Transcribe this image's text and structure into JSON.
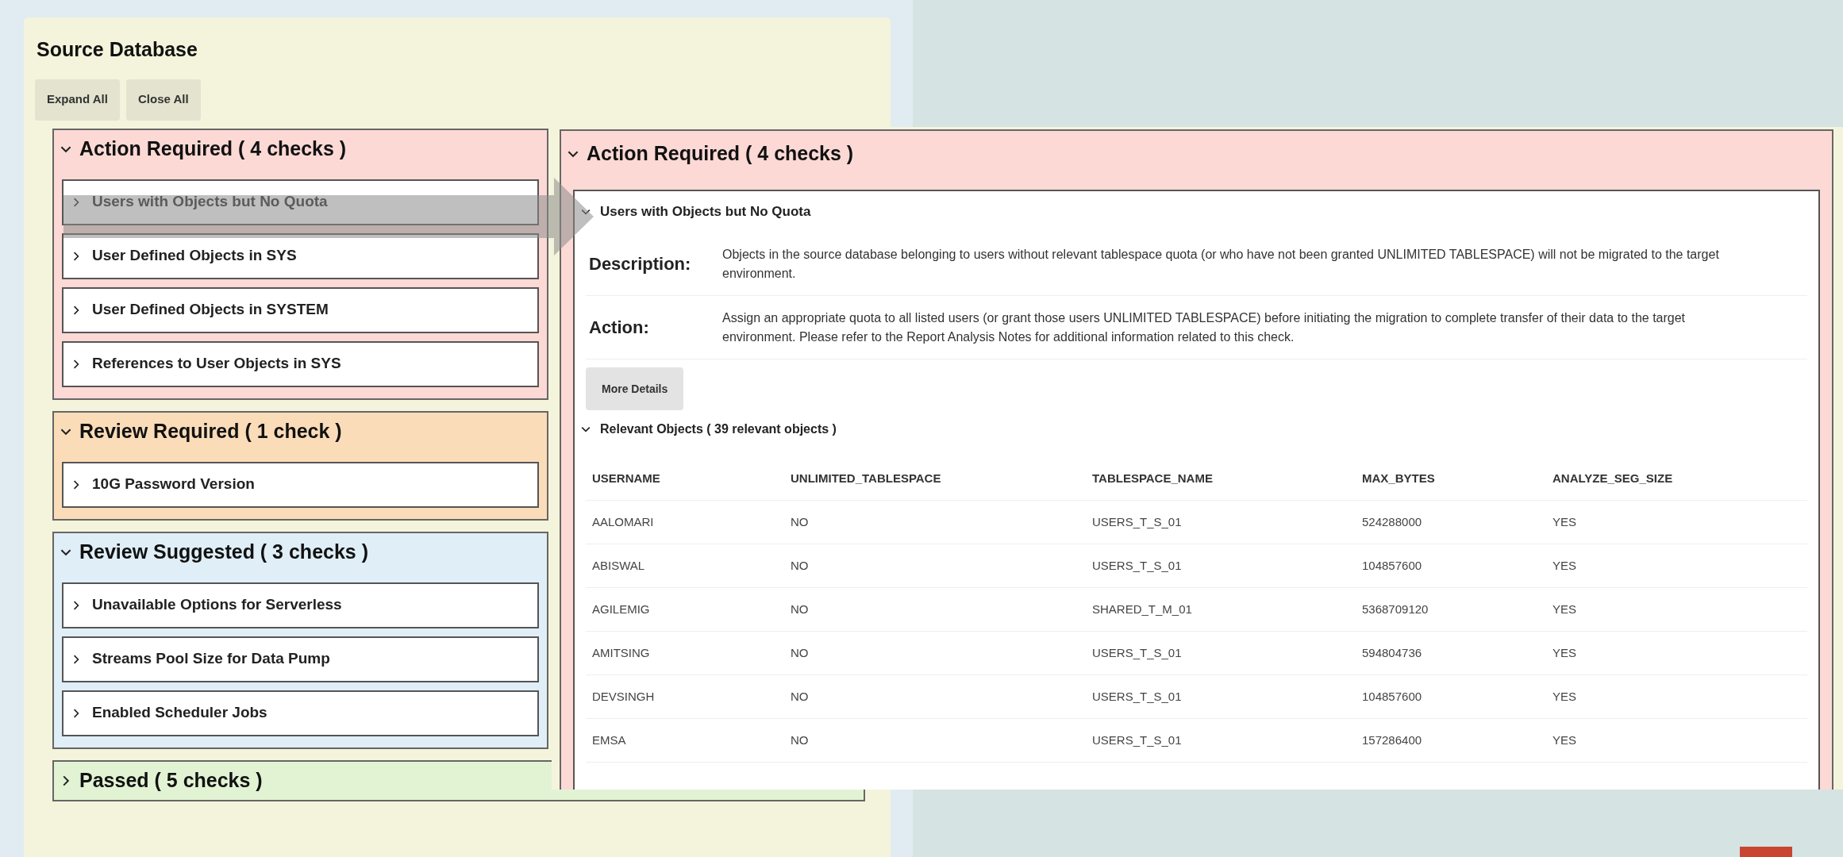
{
  "panel": {
    "title": "Source Database",
    "buttons": [
      "Expand All",
      "Close All"
    ],
    "sections": [
      {
        "kind": "action",
        "title": "Action Required ( 4 checks )",
        "expanded": true,
        "items": [
          "Users with Objects but No Quota",
          "User Defined Objects in SYS",
          "User Defined Objects in SYSTEM",
          "References to User Objects in SYS"
        ]
      },
      {
        "kind": "review_required",
        "title": "Review Required ( 1 check )",
        "expanded": true,
        "items": [
          "10G Password Version"
        ]
      },
      {
        "kind": "review_suggested",
        "title": "Review Suggested ( 3 checks )",
        "expanded": true,
        "items": [
          "Unavailable Options for Serverless",
          "Streams Pool Size for Data Pump",
          "Enabled Scheduler Jobs"
        ]
      },
      {
        "kind": "passed",
        "title": "Passed ( 5 checks )",
        "expanded": false
      }
    ]
  },
  "callout": {
    "section": {
      "kind": "action",
      "title": "Action Required ( 4 checks )",
      "expanded": true
    },
    "check": {
      "title": "Users with Objects but No Quota",
      "expanded": true,
      "fields": [
        {
          "label": "Description:",
          "text": "Objects in the source database belonging to users without relevant tablespace quota (or who have not been granted UNLIMITED TABLESPACE) will not be migrated to the target environment."
        },
        {
          "label": "Action:",
          "text": "Assign an appropriate quota to all listed users (or grant those users UNLIMITED TABLESPACE) before initiating the migration to complete transfer of their data to the target environment. Please refer to the Report Analysis Notes for additional information related to this check."
        }
      ],
      "button": "More Details",
      "objects": {
        "title": "Relevant Objects ( 39 relevant objects )",
        "expanded": true,
        "columns": [
          "USERNAME",
          "UNLIMITED_TABLESPACE",
          "TABLESPACE_NAME",
          "MAX_BYTES",
          "ANALYZE_SEG_SIZE"
        ],
        "rows": [
          [
            "AALOMARI",
            "NO",
            "USERS_T_S_01",
            "524288000",
            "YES"
          ],
          [
            "ABISWAL",
            "NO",
            "USERS_T_S_01",
            "104857600",
            "YES"
          ],
          [
            "AGILEMIG",
            "NO",
            "SHARED_T_M_01",
            "5368709120",
            "YES"
          ],
          [
            "AMITSING",
            "NO",
            "USERS_T_S_01",
            "594804736",
            "YES"
          ],
          [
            "DEVSINGH",
            "NO",
            "USERS_T_S_01",
            "104857600",
            "YES"
          ],
          [
            "EMSA",
            "NO",
            "USERS_T_S_01",
            "157286400",
            "YES"
          ]
        ]
      }
    }
  }
}
